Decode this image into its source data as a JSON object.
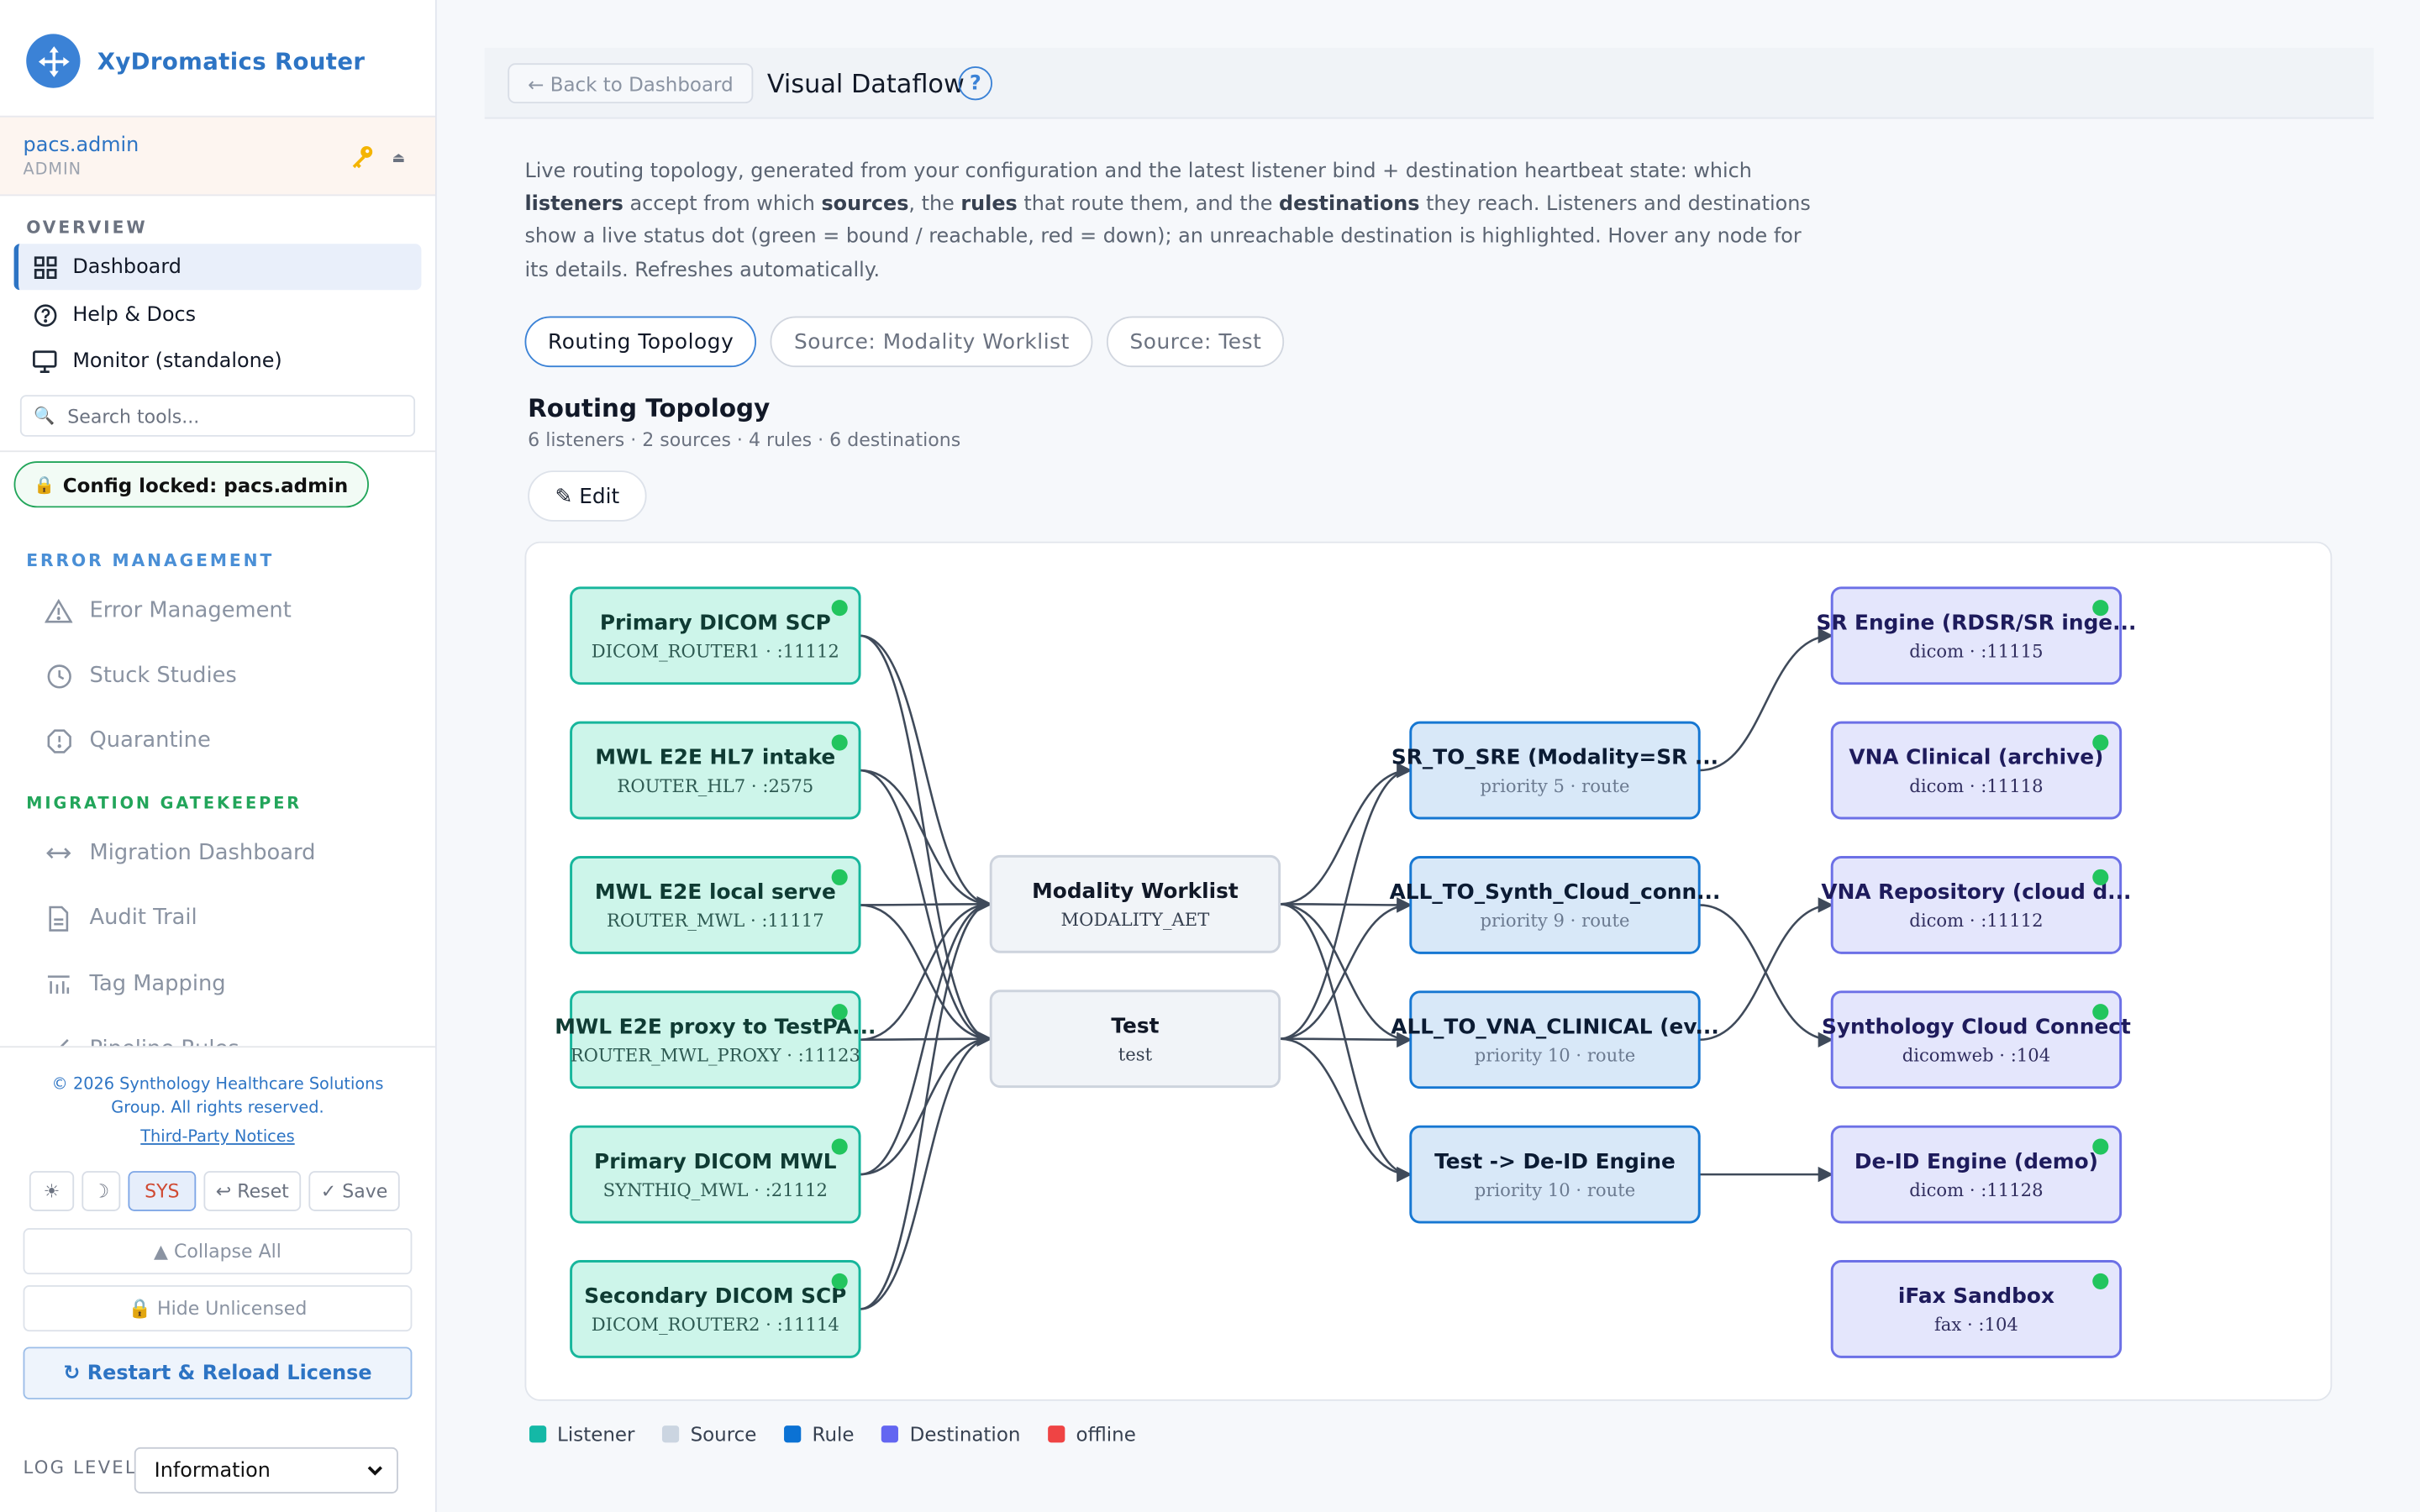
{
  "app": {
    "title": "XyDromatics Router"
  },
  "user": {
    "name": "pacs.admin",
    "role": "ADMIN"
  },
  "nav": {
    "overview_label": "OVERVIEW",
    "items": [
      {
        "label": "Dashboard",
        "icon": "grid-icon",
        "active": true
      },
      {
        "label": "Help & Docs",
        "icon": "help-circle-icon"
      },
      {
        "label": "Monitor (standalone)",
        "icon": "monitor-icon"
      }
    ],
    "search_placeholder": "Search tools...",
    "config_lock": "Config locked: pacs.admin",
    "error_section": "ERROR MANAGEMENT",
    "error_items": [
      "Error Management",
      "Stuck Studies",
      "Quarantine"
    ],
    "migration_section": "MIGRATION GATEKEEPER",
    "migration_items": [
      "Migration Dashboard",
      "Audit Trail",
      "Tag Mapping",
      "Pipeline Rules"
    ]
  },
  "footer": {
    "copyright": "© 2026 Synthology Healthcare Solutions Group. All rights reserved.",
    "third_party": "Third-Party Notices",
    "theme_light": "☀",
    "theme_dark": "☽",
    "theme_sys": "SYS",
    "reset": "↩ Reset",
    "save": "✓ Save",
    "collapse_all": "▲ Collapse All",
    "hide_unlicensed": "🔒 Hide Unlicensed",
    "restart": "↻ Restart & Reload License",
    "log_level_label": "LOG LEVEL",
    "log_level_value": "Information"
  },
  "header": {
    "back": "← Back to Dashboard",
    "title": "Visual Dataflow",
    "help": "?"
  },
  "description": {
    "p1": "Live routing topology, generated from your configuration and the latest listener bind + destination heartbeat state: which ",
    "b1": "listeners",
    "p2": " accept from which ",
    "b2": "sources",
    "p3": ", the ",
    "b3": "rules",
    "p4": " that route them, and the ",
    "b4": "destinations",
    "p5": " they reach. Listeners and destinations show a live status dot (green = bound / reachable, red = down); an unreachable destination is highlighted. Hover any node for its details. Refreshes automatically."
  },
  "tabs": [
    "Routing Topology",
    "Source: Modality Worklist",
    "Source: Test"
  ],
  "topology": {
    "title": "Routing Topology",
    "summary": "6 listeners · 2 sources · 4 rules · 6 destinations",
    "edit": "✎ Edit",
    "listeners": [
      {
        "name": "Primary DICOM SCP",
        "sub": "DICOM_ROUTER1 · :11112",
        "status": "up"
      },
      {
        "name": "MWL E2E HL7 intake",
        "sub": "ROUTER_HL7 · :2575",
        "status": "up"
      },
      {
        "name": "MWL E2E local serve",
        "sub": "ROUTER_MWL · :11117",
        "status": "up"
      },
      {
        "name": "MWL E2E proxy to TestPA...",
        "sub": "ROUTER_MWL_PROXY · :11123",
        "status": "up"
      },
      {
        "name": "Primary DICOM MWL",
        "sub": "SYNTHIQ_MWL · :21112",
        "status": "up"
      },
      {
        "name": "Secondary DICOM SCP",
        "sub": "DICOM_ROUTER2 · :11114",
        "status": "up"
      }
    ],
    "sources": [
      {
        "name": "Modality Worklist",
        "sub": "MODALITY_AET"
      },
      {
        "name": "Test",
        "sub": "test"
      }
    ],
    "rules": [
      {
        "name": "SR_TO_SRE (Modality=SR ...",
        "sub": "priority 5 · route"
      },
      {
        "name": "ALL_TO_Synth_Cloud_conn...",
        "sub": "priority 9 · route"
      },
      {
        "name": "ALL_TO_VNA_CLINICAL (ev...",
        "sub": "priority 10 · route"
      },
      {
        "name": "Test -> De-ID Engine",
        "sub": "priority 10 · route"
      }
    ],
    "destinations": [
      {
        "name": "SR Engine (RDSR/SR inge...",
        "sub": "dicom · :11115",
        "status": "up"
      },
      {
        "name": "VNA Clinical (archive)",
        "sub": "dicom · :11118",
        "status": "up"
      },
      {
        "name": "VNA Repository (cloud d...",
        "sub": "dicom · :11112",
        "status": "up"
      },
      {
        "name": "Synthology Cloud Connect",
        "sub": "dicomweb · :104",
        "status": "up"
      },
      {
        "name": "De-ID Engine (demo)",
        "sub": "dicom · :11128",
        "status": "up"
      },
      {
        "name": "iFax Sandbox",
        "sub": "fax · :104",
        "status": "up"
      }
    ],
    "edges": {
      "listener_to_source": [
        [
          0,
          0
        ],
        [
          0,
          1
        ],
        [
          1,
          0
        ],
        [
          1,
          1
        ],
        [
          2,
          0
        ],
        [
          2,
          1
        ],
        [
          3,
          0
        ],
        [
          3,
          1
        ],
        [
          4,
          0
        ],
        [
          4,
          1
        ],
        [
          5,
          0
        ],
        [
          5,
          1
        ]
      ],
      "source_to_rule": [
        [
          0,
          0
        ],
        [
          0,
          1
        ],
        [
          0,
          2
        ],
        [
          0,
          3
        ],
        [
          1,
          0
        ],
        [
          1,
          1
        ],
        [
          1,
          2
        ],
        [
          1,
          3
        ]
      ],
      "rule_to_destination": [
        [
          0,
          0
        ],
        [
          1,
          3
        ],
        [
          2,
          2
        ],
        [
          3,
          4
        ]
      ]
    }
  },
  "legend": [
    {
      "label": "Listener",
      "color": "#14b8a6"
    },
    {
      "label": "Source",
      "color": "#cbd5e1"
    },
    {
      "label": "Rule",
      "color": "#0b72d4"
    },
    {
      "label": "Destination",
      "color": "#6366f1"
    },
    {
      "label": "offline",
      "color": "#ef4444"
    }
  ],
  "colors": {
    "accent": "#2d74c4",
    "status_up": "#22c55e",
    "status_down": "#ef4444"
  }
}
